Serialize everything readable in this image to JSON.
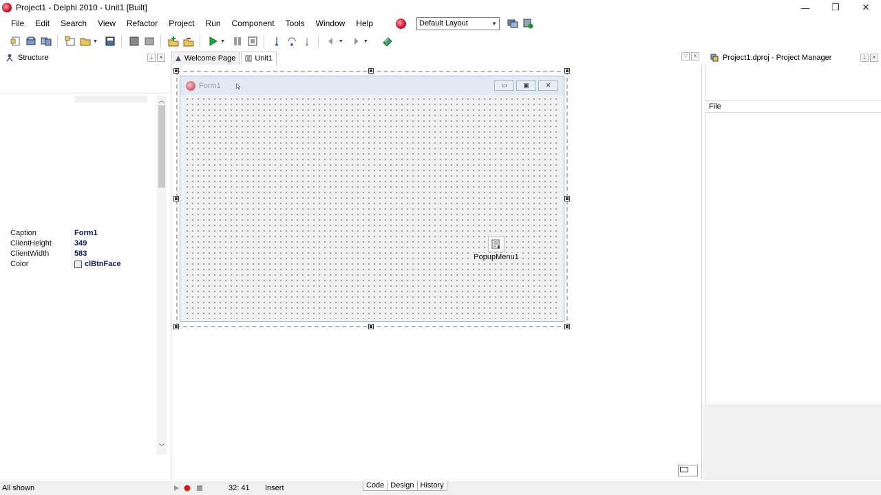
{
  "window": {
    "title": "Project1 - Delphi 2010 - Unit1 [Built]",
    "controls": {
      "minimize": "—",
      "restore": "❐",
      "close": "✕"
    }
  },
  "menu": {
    "items": [
      "File",
      "Edit",
      "Search",
      "View",
      "Refactor",
      "Project",
      "Run",
      "Component",
      "Tools",
      "Window",
      "Help"
    ],
    "layout_select": "Default Layout"
  },
  "structure_panel": {
    "title": "Structure"
  },
  "object_inspector": {
    "properties": [
      {
        "name": "Caption",
        "value": "Form1"
      },
      {
        "name": "ClientHeight",
        "value": "349"
      },
      {
        "name": "ClientWidth",
        "value": "583"
      },
      {
        "name": "Color",
        "value": "clBtnFace"
      }
    ]
  },
  "editor": {
    "tabs": [
      {
        "label": "Welcome Page",
        "active": false
      },
      {
        "label": "Unit1",
        "active": true
      }
    ],
    "form": {
      "caption": "Form1",
      "components": [
        {
          "label": "PopupMenu1",
          "icon": "popup-menu-icon"
        }
      ]
    },
    "bottom_tabs": [
      "Code",
      "Design",
      "History"
    ]
  },
  "project_manager": {
    "title": "Project1.dproj - Project Manager",
    "column_header": "File"
  },
  "status": {
    "left_text": "All shown",
    "position": "32:  41",
    "mode": "Insert"
  },
  "colors": {
    "accent_red": "#c8102e",
    "form_title_bg": "#e2eaf4",
    "property_value": "#0b1d6b"
  }
}
